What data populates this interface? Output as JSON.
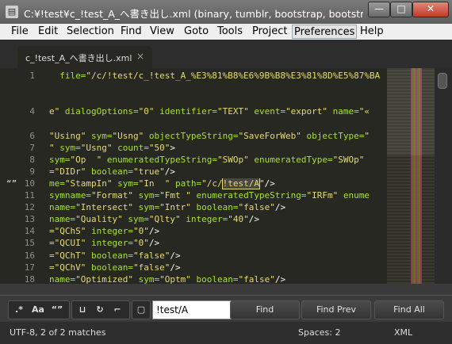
{
  "window": {
    "icon_glyph": "▤",
    "title": "C:¥!test¥c_!test_A_へ書き出し.xml (binary, tumblr, bootstrap, bootstra",
    "minimize": "—",
    "maximize": "□",
    "close": "✕"
  },
  "menu": [
    "File",
    "Edit",
    "Selection",
    "Find",
    "View",
    "Goto",
    "Tools",
    "Project",
    "Preferences",
    "Help"
  ],
  "tab": {
    "label": "c_!test_A_へ書き出し.xml",
    "close": "×"
  },
  "gutter": [
    "1",
    "",
    "",
    "4",
    "",
    "6",
    "7",
    "8",
    "9",
    "10",
    "11",
    "12",
    "13",
    "14",
    "15",
    "16",
    "17",
    "18"
  ],
  "gutter_mark": "“”",
  "code": [
    [
      [
        "t",
        "  file="
      ],
      [
        "s",
        "\"/c/!test/c_!test_A_%E3%81%B8%E6%9B%B8%E3%81%8D%E5%87%BA"
      ]
    ],
    [],
    [],
    [
      [
        "s",
        "e\""
      ],
      [
        "t",
        " dialogOptions="
      ],
      [
        "s",
        "\"0\""
      ],
      [
        "t",
        " identifier="
      ],
      [
        "s",
        "\"TEXT\""
      ],
      [
        "t",
        " event="
      ],
      [
        "s",
        "\"export\""
      ],
      [
        "t",
        " name="
      ],
      [
        "s",
        "\"«"
      ]
    ],
    [],
    [
      [
        "s",
        "\"Using\""
      ],
      [
        "t",
        " sym="
      ],
      [
        "s",
        "\"Usng\""
      ],
      [
        "t",
        " objectTypeString="
      ],
      [
        "s",
        "\"SaveForWeb\""
      ],
      [
        "t",
        " objectType="
      ],
      [
        "s",
        "\""
      ]
    ],
    [
      [
        "s",
        "\""
      ],
      [
        "t",
        " sym="
      ],
      [
        "s",
        "\"Usng\""
      ],
      [
        "t",
        " count="
      ],
      [
        "s",
        "\"50\""
      ],
      [
        "p",
        ">"
      ]
    ],
    [
      [
        "t",
        "sym="
      ],
      [
        "s",
        "\"Op  \""
      ],
      [
        "t",
        " enumeratedTypeString="
      ],
      [
        "s",
        "\"SWOp\""
      ],
      [
        "t",
        " enumeratedType="
      ],
      [
        "s",
        "\"SWOp\""
      ]
    ],
    [
      [
        "s",
        "=\"DIDr\""
      ],
      [
        "t",
        " boolean="
      ],
      [
        "s",
        "\"true\""
      ],
      [
        "p",
        "/>"
      ]
    ],
    [
      [
        "t",
        "me="
      ],
      [
        "s",
        "\"StampIn\""
      ],
      [
        "t",
        " sym="
      ],
      [
        "s",
        "\"In  \""
      ],
      [
        "t",
        " path="
      ],
      [
        "s",
        "\"/c/"
      ],
      [
        "hl",
        "!test/A"
      ],
      [
        "s",
        "\""
      ],
      [
        "p",
        "/>"
      ]
    ],
    [
      [
        "t",
        "symname="
      ],
      [
        "s",
        "\"Format\""
      ],
      [
        "t",
        " sym="
      ],
      [
        "s",
        "\"Fmt \""
      ],
      [
        "t",
        " enumeratedTypeString="
      ],
      [
        "s",
        "\"IRFm\""
      ],
      [
        "t",
        " enume"
      ]
    ],
    [
      [
        "t",
        "name="
      ],
      [
        "s",
        "\"Intersect\""
      ],
      [
        "t",
        " sym="
      ],
      [
        "s",
        "\"Intr\""
      ],
      [
        "t",
        " boolean="
      ],
      [
        "s",
        "\"false\""
      ],
      [
        "p",
        "/>"
      ]
    ],
    [
      [
        "t",
        "name="
      ],
      [
        "s",
        "\"Quality\""
      ],
      [
        "t",
        " sym="
      ],
      [
        "s",
        "\"Qlty\""
      ],
      [
        "t",
        " integer="
      ],
      [
        "s",
        "\"40\""
      ],
      [
        "p",
        "/>"
      ]
    ],
    [
      [
        "s",
        "=\"QChS\""
      ],
      [
        "t",
        " integer="
      ],
      [
        "s",
        "\"0\""
      ],
      [
        "p",
        "/>"
      ]
    ],
    [
      [
        "s",
        "=\"QCUI\""
      ],
      [
        "t",
        " integer="
      ],
      [
        "s",
        "\"0\""
      ],
      [
        "p",
        "/>"
      ]
    ],
    [
      [
        "s",
        "=\"QChT\""
      ],
      [
        "t",
        " boolean="
      ],
      [
        "s",
        "\"false\""
      ],
      [
        "p",
        "/>"
      ]
    ],
    [
      [
        "s",
        "=\"QChV\""
      ],
      [
        "t",
        " boolean="
      ],
      [
        "s",
        "\"false\""
      ],
      [
        "p",
        "/>"
      ]
    ],
    [
      [
        "t",
        "name="
      ],
      [
        "s",
        "\"Optimized\""
      ],
      [
        "t",
        " sym="
      ],
      [
        "s",
        "\"Optm\""
      ],
      [
        "t",
        " boolean="
      ],
      [
        "s",
        "\"false\""
      ],
      [
        "p",
        "/>"
      ]
    ]
  ],
  "find": {
    "opt_regex": ".*",
    "opt_case": "Aa",
    "opt_word": "“”",
    "opt_wrap": "⊔",
    "opt_selection": "↻",
    "opt_highlight": "⌐",
    "opt_context": "▢",
    "query": "!test/A",
    "find_label": "Find",
    "find_prev_label": "Find Prev",
    "find_all_label": "Find All"
  },
  "status": {
    "left": "UTF-8, 2 of 2 matches",
    "spaces": "Spaces: 2",
    "syntax": "XML"
  }
}
